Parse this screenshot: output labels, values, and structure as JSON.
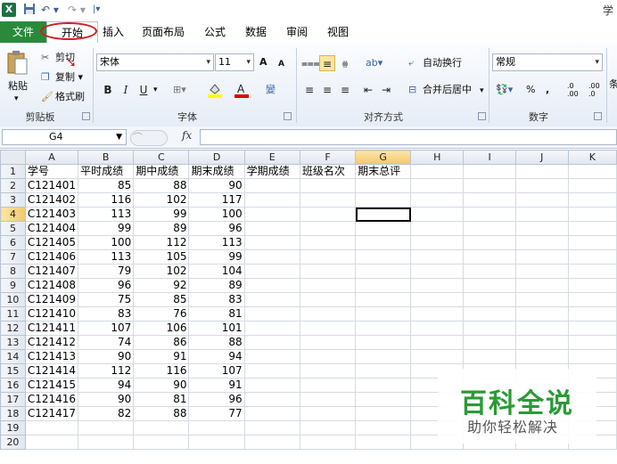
{
  "titlebar": {
    "app_icon": "X",
    "qa_undo": "↶ ▾",
    "qa_redo": "↷ ▾",
    "qa_customize": "|▾",
    "title_partial": "学"
  },
  "tabs": [
    {
      "label": "文件"
    },
    {
      "label": "开始"
    },
    {
      "label": "插入"
    },
    {
      "label": "页面布局"
    },
    {
      "label": "公式"
    },
    {
      "label": "数据"
    },
    {
      "label": "审阅"
    },
    {
      "label": "视图"
    }
  ],
  "ribbon": {
    "clipboard": {
      "label": "剪贴板",
      "paste": "粘贴",
      "cut": "剪切",
      "copy": "复制 ▾",
      "format_painter": "格式刷"
    },
    "font": {
      "label": "字体",
      "font_name": "宋体",
      "font_size": "11",
      "grow": "A",
      "shrink": "A",
      "bold": "B",
      "italic": "I",
      "underline": "U",
      "phonetic": "變"
    },
    "alignment": {
      "label": "对齐方式",
      "wrap_text": "自动换行",
      "merge_center": "合并后居中"
    },
    "number": {
      "label": "数字",
      "format": "常规",
      "percent": "%",
      "comma": ",",
      "inc_decimal": ".0 .00",
      "dec_decimal": ".00 .0"
    },
    "cutoff_right": "条"
  },
  "formula_bar": {
    "name_box": "G4",
    "fx": "fx",
    "value": ""
  },
  "sheet": {
    "columns": [
      "A",
      "B",
      "C",
      "D",
      "E",
      "F",
      "G",
      "H",
      "I",
      "J",
      "K"
    ],
    "selected_col": "G",
    "selected_row": 4,
    "header_row": [
      "学号",
      "平时成绩",
      "期中成绩",
      "期末成绩",
      "学期成绩",
      "班级名次",
      "期末总评"
    ],
    "rows": [
      [
        "C121401",
        "85",
        "88",
        "90"
      ],
      [
        "C121402",
        "116",
        "102",
        "117"
      ],
      [
        "C121403",
        "113",
        "99",
        "100"
      ],
      [
        "C121404",
        "99",
        "89",
        "96"
      ],
      [
        "C121405",
        "100",
        "112",
        "113"
      ],
      [
        "C121406",
        "113",
        "105",
        "99"
      ],
      [
        "C121407",
        "79",
        "102",
        "104"
      ],
      [
        "C121408",
        "96",
        "92",
        "89"
      ],
      [
        "C121409",
        "75",
        "85",
        "83"
      ],
      [
        "C121410",
        "83",
        "76",
        "81"
      ],
      [
        "C121411",
        "107",
        "106",
        "101"
      ],
      [
        "C121412",
        "74",
        "86",
        "88"
      ],
      [
        "C121413",
        "90",
        "91",
        "94"
      ],
      [
        "C121414",
        "112",
        "116",
        "107"
      ],
      [
        "C121415",
        "94",
        "90",
        "91"
      ],
      [
        "C121416",
        "90",
        "81",
        "96"
      ],
      [
        "C121417",
        "82",
        "88",
        "77"
      ]
    ],
    "row_numbers": [
      "1",
      "2",
      "3",
      "4",
      "5",
      "6",
      "7",
      "8",
      "9",
      "10",
      "11",
      "12",
      "13",
      "14",
      "15",
      "16",
      "17",
      "18",
      "19",
      "20"
    ]
  },
  "watermark": {
    "title": "百科全说",
    "subtitle": "助你轻松解决"
  },
  "colors": {
    "file_tab": "#2a8a3c",
    "highlight_oval": "#d21e1e",
    "watermark_green": "#2a9a36",
    "selected_header": "#f3c86a"
  }
}
